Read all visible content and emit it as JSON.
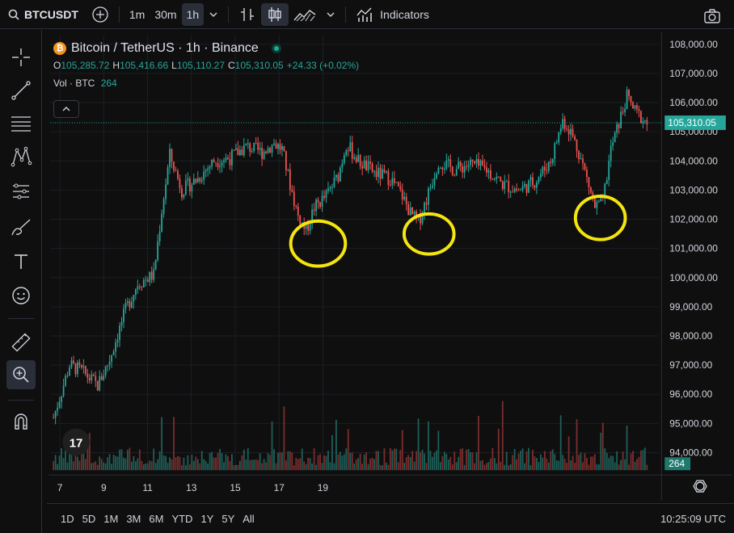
{
  "toolbar": {
    "symbol": "BTCUSDT",
    "intervals": [
      "1m",
      "30m",
      "1h"
    ],
    "active_interval": "1h",
    "indicators_label": "Indicators"
  },
  "sidebar": {
    "tools": [
      "crosshair-icon",
      "trendline-icon",
      "fib-icon",
      "pattern-icon",
      "forecast-icon",
      "brush-icon",
      "text-icon",
      "emoji-icon",
      "ruler-icon",
      "zoom-icon",
      "magnet-icon"
    ]
  },
  "legend": {
    "title": "Bitcoin / TetherUS · 1h · Binance",
    "open_label": "O",
    "open": "105,285.72",
    "high_label": "H",
    "high": "105,416.66",
    "low_label": "L",
    "low": "105,110.27",
    "close_label": "C",
    "close": "105,310.05",
    "change": "+24.33 (+0.02%)",
    "volume_label": "Vol · BTC",
    "volume": "264"
  },
  "colors": {
    "up": "#26a69a",
    "down": "#ef5350",
    "highlight": "#f5e50f",
    "background": "#0f0f0f"
  },
  "chart_data": {
    "type": "candlestick",
    "symbol": "BTCUSDT",
    "timeframe": "1h",
    "x_ticks": [
      "7",
      "9",
      "11",
      "13",
      "15",
      "17",
      "19"
    ],
    "y_ticks": [
      "108,000.00",
      "107,000.00",
      "106,000.00",
      "105,000.00",
      "104,000.00",
      "103,000.00",
      "102,000.00",
      "101,000.00",
      "100,000.00",
      "99,000.00",
      "98,000.00",
      "97,000.00",
      "96,000.00",
      "95,000.00",
      "94,000.00"
    ],
    "ylim": [
      93400,
      108300
    ],
    "last_price": 105310.05,
    "last_price_label": "105,310.05",
    "last_volume_label": "264",
    "price_path_keypoints": [
      [
        0,
        95200
      ],
      [
        8,
        97000
      ],
      [
        14,
        96800
      ],
      [
        22,
        96300
      ],
      [
        28,
        97200
      ],
      [
        36,
        98900
      ],
      [
        42,
        99800
      ],
      [
        50,
        100100
      ],
      [
        54,
        102300
      ],
      [
        58,
        104200
      ],
      [
        64,
        103000
      ],
      [
        72,
        103400
      ],
      [
        80,
        104000
      ],
      [
        88,
        104100
      ],
      [
        96,
        104500
      ],
      [
        104,
        104300
      ],
      [
        110,
        104600
      ],
      [
        114,
        104400
      ],
      [
        118,
        103200
      ],
      [
        122,
        102100
      ],
      [
        126,
        101600
      ],
      [
        130,
        102400
      ],
      [
        136,
        102800
      ],
      [
        142,
        103500
      ],
      [
        146,
        104600
      ],
      [
        152,
        104000
      ],
      [
        160,
        103600
      ],
      [
        168,
        103400
      ],
      [
        174,
        102800
      ],
      [
        178,
        102200
      ],
      [
        182,
        101900
      ],
      [
        186,
        102700
      ],
      [
        192,
        104000
      ],
      [
        200,
        103700
      ],
      [
        208,
        103900
      ],
      [
        216,
        103700
      ],
      [
        224,
        103200
      ],
      [
        232,
        103000
      ],
      [
        240,
        103300
      ],
      [
        248,
        104000
      ],
      [
        254,
        105400
      ],
      [
        258,
        105000
      ],
      [
        262,
        104300
      ],
      [
        266,
        103400
      ],
      [
        270,
        102400
      ],
      [
        274,
        102600
      ],
      [
        278,
        104400
      ],
      [
        282,
        105300
      ],
      [
        286,
        106200
      ],
      [
        290,
        105700
      ],
      [
        296,
        105300
      ]
    ],
    "range_days": [
      "7",
      "19"
    ],
    "highlighted_dips": [
      {
        "day": "12-13",
        "low": 100700
      },
      {
        "day": "15",
        "low": 101300
      },
      {
        "day": "19",
        "low": 101900
      }
    ]
  },
  "bottom": {
    "ranges": [
      "1D",
      "5D",
      "1M",
      "3M",
      "6M",
      "YTD",
      "1Y",
      "5Y",
      "All"
    ],
    "time": "10:25:09 UTC"
  }
}
